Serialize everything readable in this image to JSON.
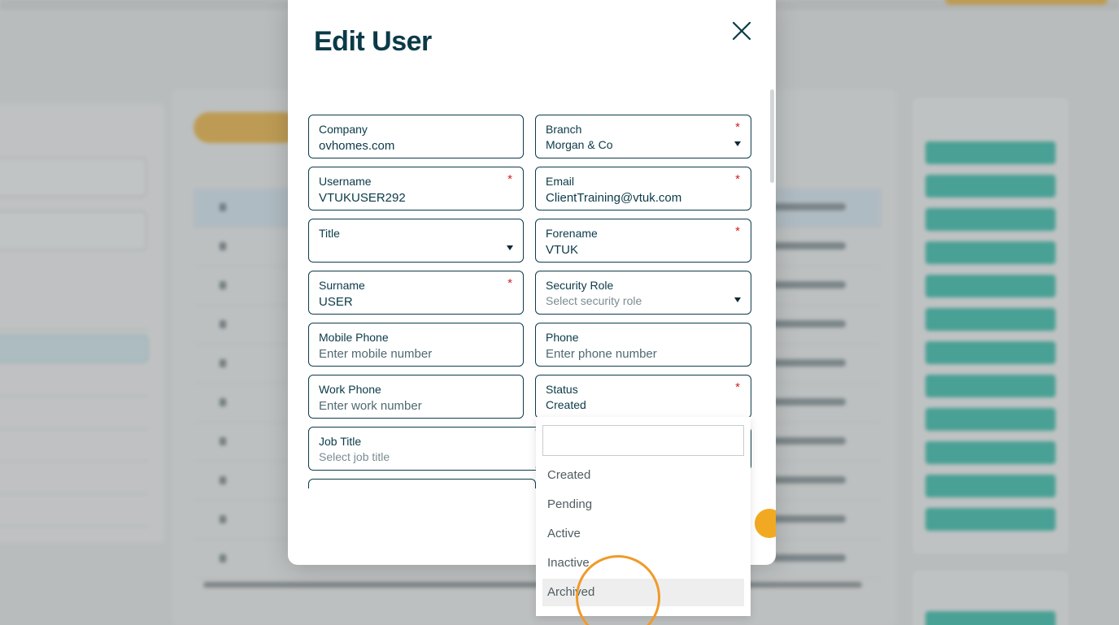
{
  "modal": {
    "title": "Edit User",
    "close_icon": "close-icon"
  },
  "form": {
    "company": {
      "label": "Company",
      "value": "ovhomes.com"
    },
    "branch": {
      "label": "Branch",
      "required_mark": "*",
      "value": "Morgan & Co"
    },
    "username": {
      "label": "Username",
      "required_mark": "*",
      "value": "VTUKUSER292"
    },
    "email": {
      "label": "Email",
      "required_mark": "*",
      "value": "ClientTraining@vtuk.com"
    },
    "title": {
      "label": "Title",
      "value": ""
    },
    "forename": {
      "label": "Forename",
      "required_mark": "*",
      "value": "VTUK"
    },
    "surname": {
      "label": "Surname",
      "required_mark": "*",
      "value": "USER"
    },
    "security_role": {
      "label": "Security Role",
      "placeholder": "Select security role"
    },
    "mobile_phone": {
      "label": "Mobile Phone",
      "placeholder": "Enter mobile number"
    },
    "phone": {
      "label": "Phone",
      "placeholder": "Enter phone number"
    },
    "work_phone": {
      "label": "Work Phone",
      "placeholder": "Enter work number"
    },
    "status": {
      "label": "Status",
      "required_mark": "*",
      "value": "Created"
    },
    "job_title": {
      "label": "Job Title",
      "placeholder": "Select job title"
    }
  },
  "status_dropdown": {
    "search_value": "",
    "options": [
      "Created",
      "Pending",
      "Active",
      "Inactive",
      "Archived"
    ],
    "hovered": "Archived"
  },
  "colors": {
    "primary_text": "#0b3a47",
    "required": "#d41f1f",
    "accent_orange": "#f2a922",
    "tag_teal": "#3ec0ad"
  }
}
